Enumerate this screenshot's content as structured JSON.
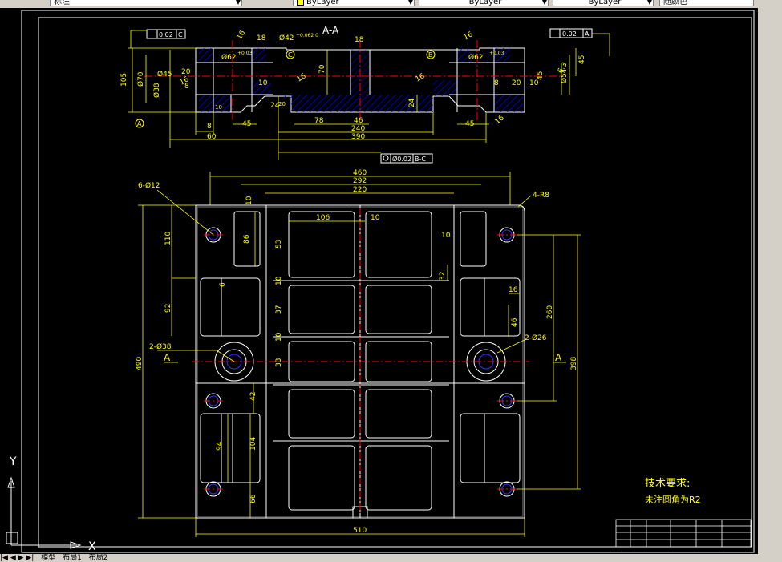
{
  "toolbar": {
    "style_box": "标注",
    "layer_box": "ByLayer",
    "linetype_box": "ByLayer",
    "lineweight_box": "ByLayer",
    "plotstyle_box": "随颜色"
  },
  "status": {
    "nav": "|◀ ◀ ▶ ▶|",
    "tab_model": "模型",
    "tab_layout1": "布局1",
    "tab_layout2": "布局2"
  },
  "ucs": {
    "x_label": "X",
    "y_label": "Y"
  },
  "drawing": {
    "section_title": "A-A",
    "tol_top_left": "0.02",
    "tol_top_left_ref": "C",
    "tol_top_right": "0.02",
    "tol_top_right_ref": "A",
    "tol_bottom": "Ø0.02",
    "tol_bottom_ref": "B-C",
    "dims_section": {
      "d18_left": "18",
      "d18_mid": "18",
      "phi42": "Ø42",
      "phi42_tol": "+0.062 0",
      "phi62_left": "Ø62",
      "phi62_right": "Ø62",
      "tol_03": "+0.03",
      "d16_a": "16",
      "d16_b": "16",
      "d16_c": "16",
      "d16_d": "16",
      "d16_e": "16",
      "d105": "105",
      "d70": "70",
      "d70b": "Ø70",
      "d45": "45",
      "d45b": "Ø45",
      "d20": "20",
      "d20b": "20",
      "d8": "8",
      "d8b": "8",
      "d8c": "8",
      "d10": "10",
      "d10b": "10",
      "d24": "24",
      "d24b": "24",
      "d60": "60",
      "d45c": "45",
      "d45d": "45",
      "d78": "78",
      "d46": "46",
      "d240": "240",
      "d390": "390",
      "d63": "6.3",
      "d54": "Ø54",
      "d38": "Ø38",
      "label_A": "A",
      "label_B": "B",
      "label_C": "C"
    },
    "dims_plan": {
      "d460": "460",
      "d292": "292",
      "d220": "220",
      "d106": "106",
      "d10a": "10",
      "d10b": "10",
      "d10c": "10",
      "d10d": "10",
      "d10e": "10",
      "hole12": "6-Ø12",
      "r8": "4-R8",
      "d110": "110",
      "d86": "86",
      "d53": "53",
      "d6": "6",
      "d92": "92",
      "d37": "37",
      "d32": "32",
      "d16": "16",
      "d46": "46",
      "d260": "260",
      "d398": "398",
      "hole38": "2-Ø38",
      "hole26": "2-Ø26",
      "d490": "490",
      "d33": "33",
      "d42": "42",
      "d94": "94",
      "d104": "104",
      "d66": "66",
      "d510": "510",
      "cut_A_left": "A",
      "cut_A_right": "A"
    },
    "notes_title": "技术要求:",
    "notes_line": "未注圆角为R2"
  },
  "colors": {
    "outline": "#ffffff",
    "dim": "#ffff00",
    "center": "#ff0000",
    "hatch": "#0000ff",
    "circle2": "#3333ff"
  }
}
